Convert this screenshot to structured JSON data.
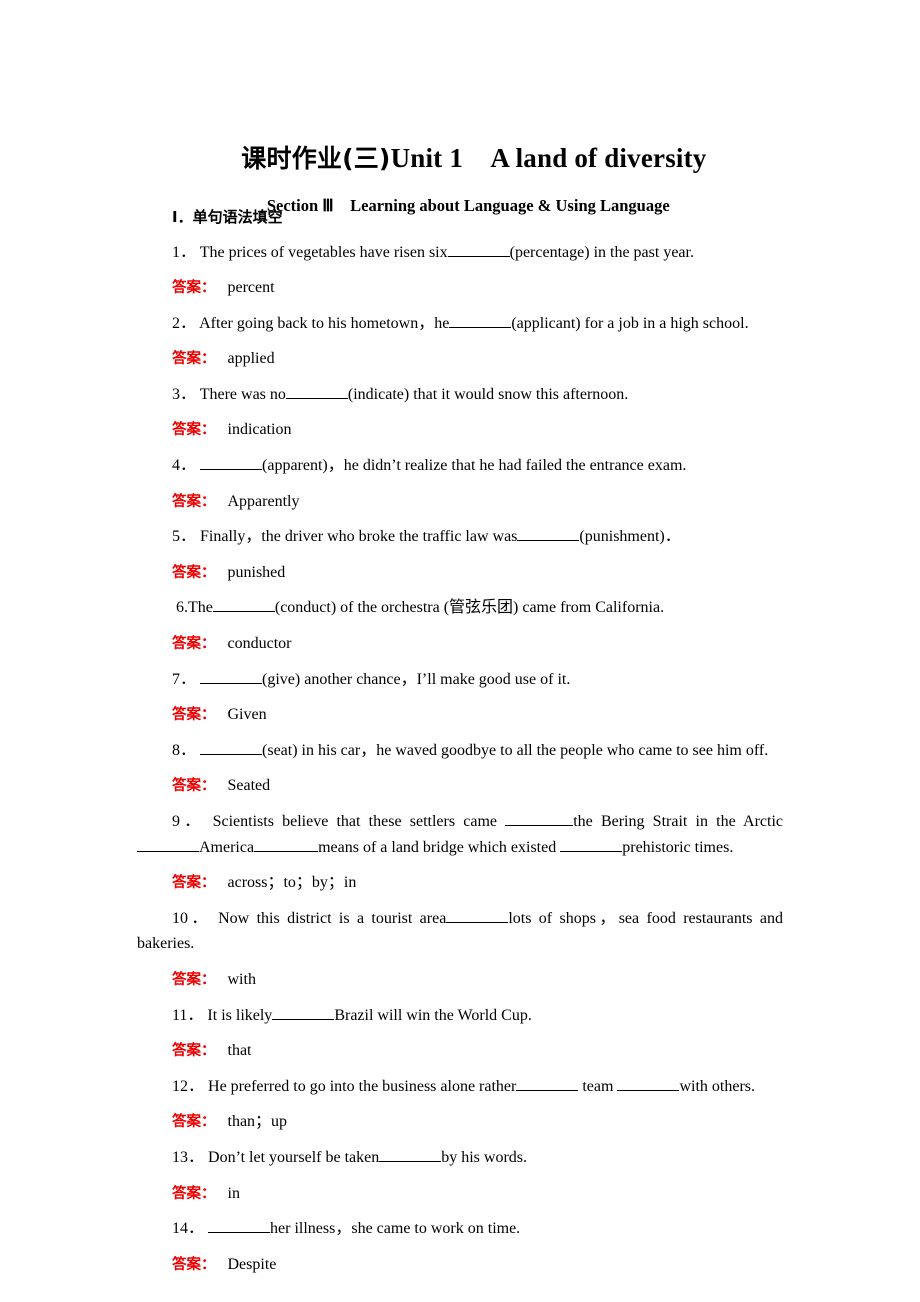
{
  "document": {
    "title_cn": "课时作业(三)",
    "title_en": "Unit 1  A land of diversity",
    "section_label": "Section Ⅲ",
    "section_name": "Learning about Language & Using Language",
    "part_heading": "Ⅰ．单句语法填空",
    "answer_label": "答案：",
    "answer_color": "#ee0000",
    "text_color": "#000000",
    "background": "#ffffff"
  },
  "questions": [
    {
      "number": "1．",
      "before": "The prices of vegetables have risen six",
      "after": "(percentage) in the past year.",
      "answer": "percent",
      "layout": "simple"
    },
    {
      "number": "2．",
      "before": "After going back to his hometown，he",
      "after": "(applicant) for a job in a high school.",
      "answer": "applied",
      "layout": "simple"
    },
    {
      "number": "3．",
      "before": "There was no",
      "after": "(indicate) that it would snow this afternoon.",
      "answer": "indication",
      "layout": "simple"
    },
    {
      "number": "4．",
      "before": "",
      "after": "(apparent)，he didn’t realize that he had failed the entrance exam.",
      "answer": "Apparently",
      "layout": "simple"
    },
    {
      "number": "5．",
      "before": "Finally，the driver who broke the traffic law was",
      "after": "(punishment)．",
      "answer": "punished",
      "layout": "simple"
    },
    {
      "number": "6.",
      "before": "The",
      "after": "(conduct) of the orchestra (管弦乐团) came from California.",
      "answer": "conductor",
      "layout": "tight"
    },
    {
      "number": "7．",
      "before": "",
      "after": "(give) another chance，I’ll make good use of it.",
      "answer": "Given",
      "layout": "simple"
    },
    {
      "number": "8．",
      "before": "",
      "after": "(seat) in his car，he waved goodbye to all the people who came to see him off.",
      "answer": "Seated",
      "layout": "simple"
    },
    {
      "number": "9．",
      "line1_before": "Scientists believe that these settlers came",
      "line1_after": "the Bering Strait in the Arctic",
      "line2_mid": "America",
      "line2_after1": "means of a land bridge which existed",
      "line2_after2": "prehistoric times.",
      "answer": "across；to；by；in",
      "layout": "two-line-justified"
    },
    {
      "number": "10．",
      "before": "Now this district is a tourist area",
      "after": "lots of shops，sea food restaurants and",
      "wrap": "bakeries.",
      "answer": "with",
      "layout": "wrapped"
    },
    {
      "number": "11．",
      "before": "It is likely",
      "after": "Brazil will win the World Cup.",
      "answer": "that",
      "layout": "simple"
    },
    {
      "number": "12．",
      "before": "He preferred to go into the business alone rather",
      "mid": " team ",
      "after": "with others.",
      "answer": "than；up",
      "layout": "double-blank"
    },
    {
      "number": "13．",
      "before": "Don’t let yourself be taken",
      "after": "by his words.",
      "answer": "in",
      "layout": "simple"
    },
    {
      "number": "14．",
      "before": "",
      "after": "her illness，she came to work on time.",
      "answer": "Despite",
      "layout": "simple"
    }
  ]
}
